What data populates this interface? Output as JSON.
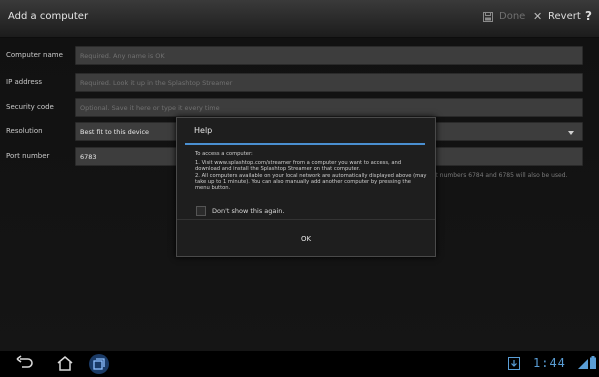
{
  "action_bar": {
    "title": "Add a computer",
    "done_label": "Done",
    "revert_label": "Revert",
    "help_label": "?"
  },
  "form": {
    "rows": [
      {
        "label": "Computer name",
        "placeholder": "Required. Any name is OK",
        "value": ""
      },
      {
        "label": "IP address",
        "placeholder": "Required. Look it up in the Splashtop Streamer",
        "value": ""
      },
      {
        "label": "Security code",
        "placeholder": "Optional. Save it here or type it every time",
        "value": ""
      },
      {
        "label": "Resolution",
        "placeholder": "",
        "value": "Best fit to this device"
      },
      {
        "label": "Port number",
        "placeholder": "",
        "value": "6783"
      }
    ],
    "port_note": "Port numbers 6784 and 6785 will also be used."
  },
  "dialog": {
    "title": "Help",
    "intro": "To access a computer:",
    "step1": "1. Visit www.splashtop.com/streamer from a computer you want to access, and download and install the Splashtop Streamer on that computer.",
    "step2": "2. All computers available on your local network are automatically displayed above (may take up to 1 minute). You can also manually add another computer by pressing the menu button.",
    "checkbox_label": "Don't show this again.",
    "ok_label": "OK"
  },
  "system_bar": {
    "clock": "1:44"
  },
  "colors": {
    "accent": "#4a8fd1",
    "field_bg": "#3d3d3d"
  }
}
